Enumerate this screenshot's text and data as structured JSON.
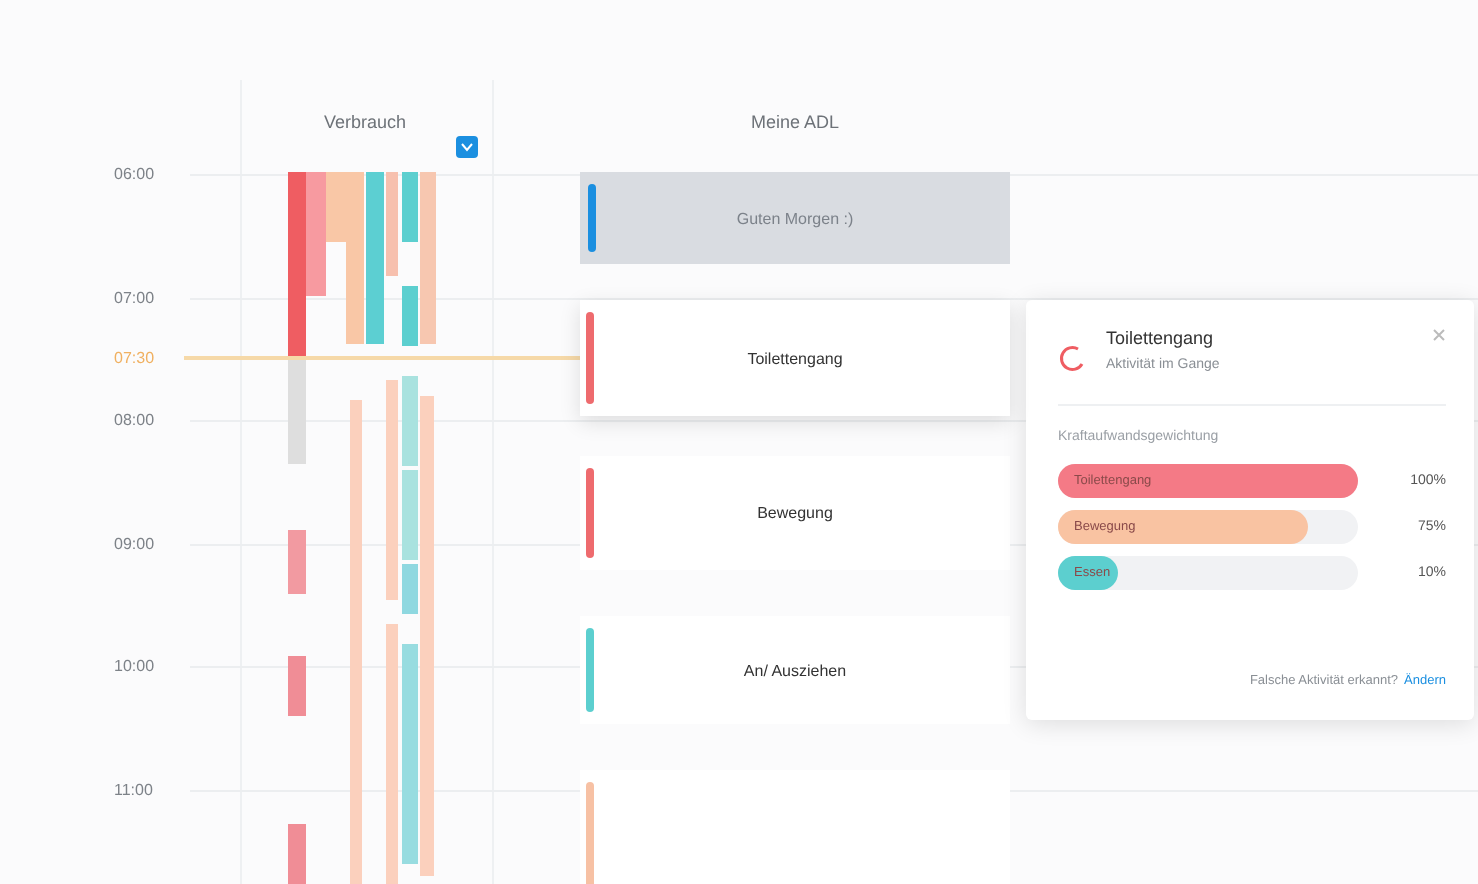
{
  "columns": {
    "usage": "Verbrauch",
    "activities": "Meine ADL"
  },
  "hours": [
    "06:00",
    "07:00",
    "08:00",
    "09:00",
    "10:00",
    "11:00"
  ],
  "now": {
    "label": "07:30"
  },
  "cards": [
    {
      "kind": "greeting",
      "label": "Guten Morgen :)",
      "color": "#1b8fe0",
      "selected": false
    },
    {
      "kind": "activity",
      "label": "Toilettengang",
      "color": "#ee6b6e",
      "selected": true
    },
    {
      "kind": "activity",
      "label": "Bewegung",
      "color": "#ee6b6e",
      "selected": false
    },
    {
      "kind": "activity",
      "label": "An/ Ausziehen",
      "color": "#5ccfcf",
      "selected": false
    },
    {
      "kind": "activity",
      "color": "#f7c1a4",
      "selected": false
    }
  ],
  "popup": {
    "title": "Toilettengang",
    "subtitle": "Aktivität im Gange",
    "section": "Kraftaufwandsgewichtung",
    "bars": [
      {
        "label": "Toilettengang",
        "level": 1,
        "reading": "100%",
        "color": "#f47a86"
      },
      {
        "label": "Bewegung",
        "level": 0.83,
        "reading": "75%",
        "color": "#f9c3a2"
      },
      {
        "label": "Essen",
        "level": 0.2,
        "reading": "10%",
        "color": "#5ccfcf"
      }
    ],
    "footer": "Falsche Aktivität erkannt?",
    "link": "Ändern"
  }
}
